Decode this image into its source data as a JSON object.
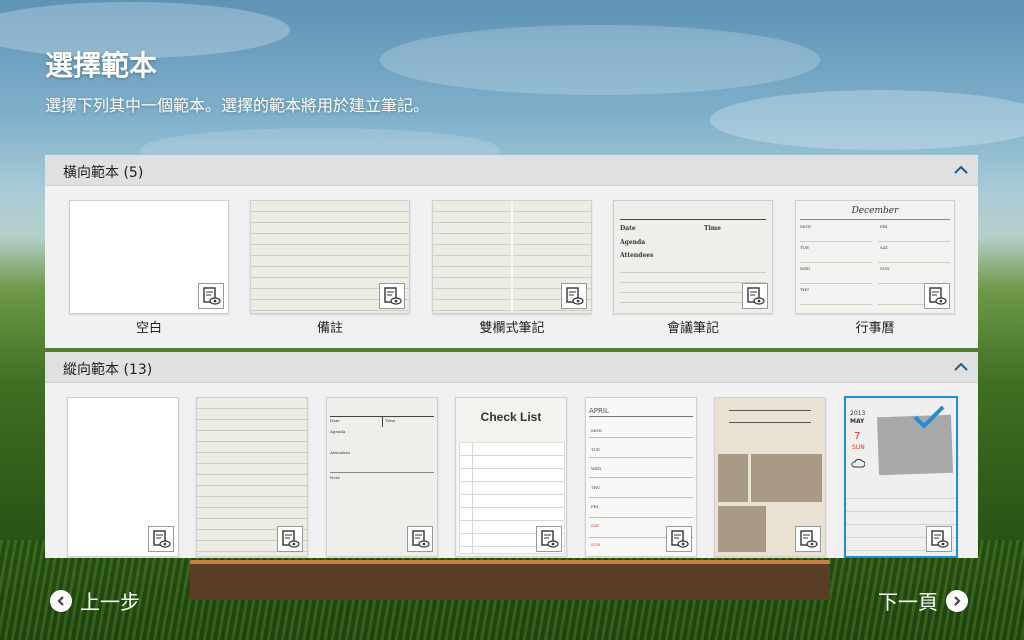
{
  "header": {
    "title": "選擇範本",
    "subtitle": "選擇下列其中一個範本。選擇的範本將用於建立筆記。"
  },
  "landscape": {
    "title": "橫向範本 (5)",
    "items": [
      {
        "label": "空白"
      },
      {
        "label": "備註"
      },
      {
        "label": "雙欄式筆記"
      },
      {
        "label": "會議筆記"
      },
      {
        "label": "行事曆"
      }
    ]
  },
  "portrait": {
    "title": "縱向範本 (13)",
    "selected_index": 6
  },
  "thumb_text": {
    "date": "Date",
    "time": "Time",
    "agenda": "Agenda",
    "attendees": "Attendees",
    "note": "Note",
    "december": "December",
    "checklist": "Check List",
    "april": "APRIL",
    "year": "2013",
    "may": "MAY",
    "day": "7",
    "sun": "SUN",
    "weekdays": [
      "MON",
      "TUE",
      "WED",
      "THU",
      "FRI",
      "SAT",
      "SUN"
    ]
  },
  "footer": {
    "prev_label": "上一步",
    "next_label": "下一頁"
  },
  "colors": {
    "accent": "#1f8fd6",
    "header_bg": "#e0e0e0"
  }
}
